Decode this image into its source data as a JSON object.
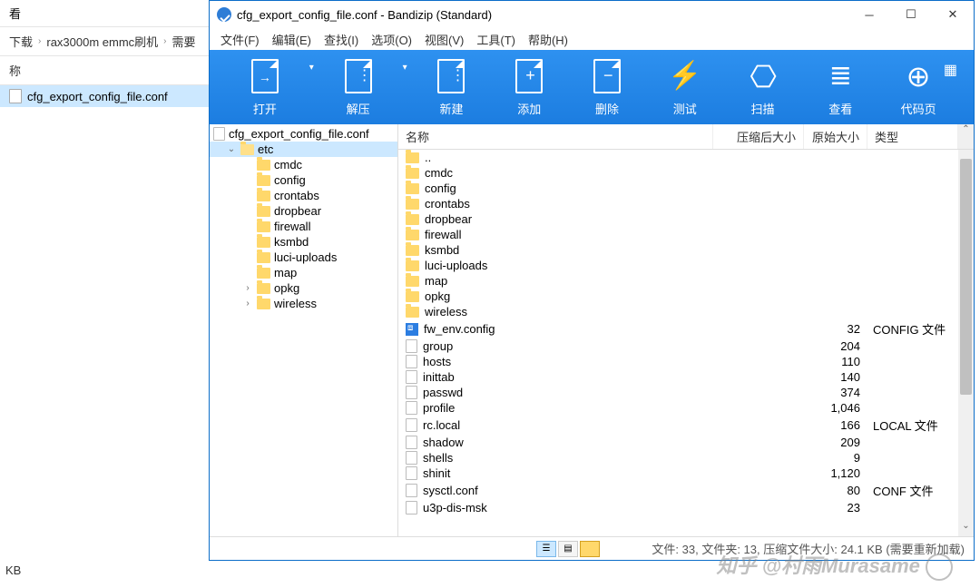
{
  "explorer": {
    "view_btn": "看",
    "breadcrumb": [
      "下载",
      "rax3000m emmc刷机",
      "需要"
    ],
    "column": "称",
    "selected_file": "cfg_export_config_file.conf",
    "footer": "KB"
  },
  "window": {
    "title": "cfg_export_config_file.conf - Bandizip (Standard)"
  },
  "menu": [
    "文件(F)",
    "编辑(E)",
    "查找(I)",
    "选项(O)",
    "视图(V)",
    "工具(T)",
    "帮助(H)"
  ],
  "toolbar": {
    "open": "打开",
    "extract": "解压",
    "new": "新建",
    "add": "添加",
    "delete": "删除",
    "test": "测试",
    "scan": "扫描",
    "view": "查看",
    "codepage": "代码页"
  },
  "tree": {
    "root": "cfg_export_config_file.conf",
    "etc_label": "etc",
    "items": [
      "cmdc",
      "config",
      "crontabs",
      "dropbear",
      "firewall",
      "ksmbd",
      "luci-uploads",
      "map",
      "opkg",
      "wireless"
    ],
    "expandable": [
      "opkg",
      "wireless"
    ]
  },
  "list": {
    "headers": {
      "name": "名称",
      "compressed": "压缩后大小",
      "original": "原始大小",
      "type": "类型"
    },
    "parent": "..",
    "folders": [
      "cmdc",
      "config",
      "crontabs",
      "dropbear",
      "firewall",
      "ksmbd",
      "luci-uploads",
      "map",
      "opkg",
      "wireless"
    ],
    "files": [
      {
        "name": "fw_env.config",
        "orig": "32",
        "type": "CONFIG 文件",
        "icon": "vs"
      },
      {
        "name": "group",
        "orig": "204",
        "type": ""
      },
      {
        "name": "hosts",
        "orig": "110",
        "type": ""
      },
      {
        "name": "inittab",
        "orig": "140",
        "type": ""
      },
      {
        "name": "passwd",
        "orig": "374",
        "type": ""
      },
      {
        "name": "profile",
        "orig": "1,046",
        "type": ""
      },
      {
        "name": "rc.local",
        "orig": "166",
        "type": "LOCAL 文件"
      },
      {
        "name": "shadow",
        "orig": "209",
        "type": ""
      },
      {
        "name": "shells",
        "orig": "9",
        "type": ""
      },
      {
        "name": "shinit",
        "orig": "1,120",
        "type": ""
      },
      {
        "name": "sysctl.conf",
        "orig": "80",
        "type": "CONF 文件"
      },
      {
        "name": "u3p-dis-msk",
        "orig": "23",
        "type": ""
      }
    ]
  },
  "statusbar": {
    "text": "文件: 33, 文件夹: 13, 压缩文件大小: 24.1 KB (需要重新加载)"
  },
  "watermark": "知乎 @村雨Murasame"
}
